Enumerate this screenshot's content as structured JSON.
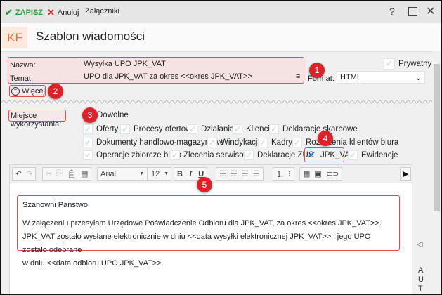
{
  "toolbar": {
    "save": "ZAPISZ",
    "cancel": "Anuluj",
    "attachments": "Załączniki",
    "help": "?"
  },
  "header": {
    "logo": "KF",
    "title": "Szablon wiadomości"
  },
  "form": {
    "name_label": "Nazwa:",
    "name_value": "Wysyłka UPO JPK_VAT",
    "subject_label": "Temat:",
    "subject_value": "UPO dla JPK_VAT za okres <<okres JPK_VAT>>",
    "private_label": "Prywatny",
    "format_label": "Format:",
    "format_value": "HTML",
    "more_label": "Więcej"
  },
  "usage": {
    "label": "Miejsce wykorzystania:",
    "any": "Dowolne",
    "options": [
      {
        "label": "Oferty",
        "checked": false
      },
      {
        "label": "Procesy ofertowe",
        "checked": false
      },
      {
        "label": "Działania",
        "checked": false
      },
      {
        "label": "Klienci",
        "checked": false
      },
      {
        "label": "Deklaracje skarbowe",
        "checked": false
      },
      {
        "label": "Dokumenty handlowo-magazynowe",
        "checked": false
      },
      {
        "label": "Windykacja",
        "checked": false
      },
      {
        "label": "Kadry",
        "checked": false
      },
      {
        "label": "Rozliczenia klientów biura",
        "checked": false
      },
      {
        "label": "Operacje zbiorcze biura",
        "checked": false
      },
      {
        "label": "Zlecenia serwisowe",
        "checked": false
      },
      {
        "label": "Deklaracje ZUS",
        "checked": false
      },
      {
        "label": "JPK_VAT",
        "checked": true
      },
      {
        "label": "Ewidencje",
        "checked": false
      }
    ]
  },
  "editor": {
    "font": "Arial",
    "size": "12",
    "bold": "B",
    "italic": "I",
    "underline": "U",
    "line1": "Szanowni Państwo.",
    "line2": "W załączeniu przesyłam Urzędowe Poświadczenie Odbioru dla JPK_VAT, za okres <<okres JPK_VAT>>.",
    "line3": "JPK_VAT zostało wysłane elektronicznie w dniu <<data wysyłki elektronicznej JPK_VAT>> i jego UPO zostało odebrane",
    "line4": "w dniu <<data odbioru UPO JPK_VAT>>."
  },
  "side": {
    "collapse": "◁",
    "vertical": "AUT"
  },
  "badges": [
    "1",
    "2",
    "3",
    "4",
    "5"
  ]
}
